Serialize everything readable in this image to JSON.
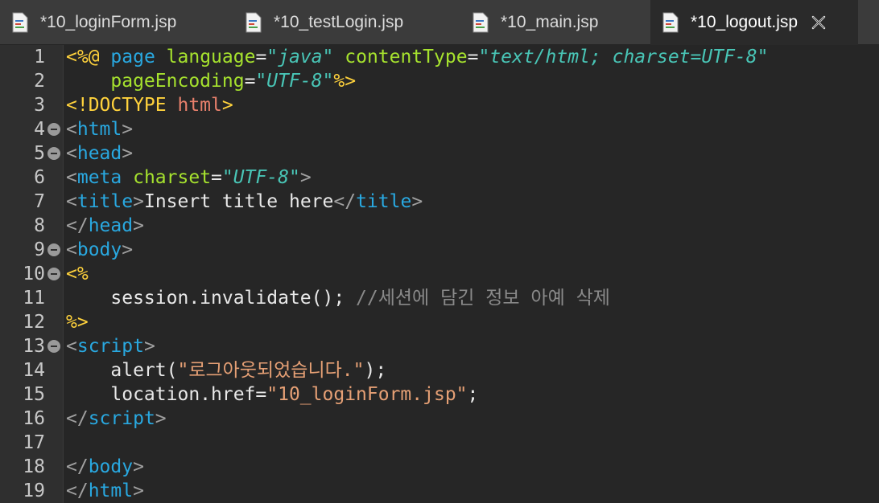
{
  "tabs": [
    {
      "label": "*10_loginForm.jsp",
      "active": false
    },
    {
      "label": "*10_testLogin.jsp",
      "active": false
    },
    {
      "label": "*10_main.jsp",
      "active": false
    },
    {
      "label": "*10_logout.jsp",
      "active": true
    }
  ],
  "line_numbers": [
    "1",
    "2",
    "3",
    "4",
    "5",
    "6",
    "7",
    "8",
    "9",
    "10",
    "11",
    "12",
    "13",
    "14",
    "15",
    "16",
    "17",
    "18",
    "19"
  ],
  "code": {
    "l1": {
      "open": "<%@",
      "page": "page",
      "a1": "language",
      "eq1": "=",
      "v1": "\"java\"",
      "a2": "contentType",
      "eq2": "=",
      "v2": "\"text/html; charset=UTF-8\""
    },
    "l2": {
      "a1": "pageEncoding",
      "eq1": "=",
      "v1": "\"UTF-8\"",
      "close": "%>"
    },
    "l3": {
      "text": "<!DOCTYPE",
      "name": "html",
      "close": ">"
    },
    "l4": {
      "tag": "html"
    },
    "l5": {
      "tag": "head"
    },
    "l6": {
      "tag": "meta",
      "attr": "charset",
      "eq": "=",
      "val": "\"UTF-8\""
    },
    "l7": {
      "tag": "title",
      "text": "Insert title here"
    },
    "l8": {
      "tag": "head"
    },
    "l9": {
      "tag": "body"
    },
    "l10": {
      "text": "<%"
    },
    "l11": {
      "code": "session.invalidate();",
      "comment": "//세션에 담긴 정보 아예 삭제"
    },
    "l12": {
      "text": "%>"
    },
    "l13": {
      "tag": "script"
    },
    "l14": {
      "fn": "alert(",
      "str": "\"로그아웃되었습니다.\"",
      "end": ");"
    },
    "l15": {
      "code": "location.href=",
      "str": "\"10_loginForm.jsp\"",
      "end": ";"
    },
    "l16": {
      "tag": "script"
    },
    "l18": {
      "tag": "body"
    },
    "l19": {
      "tag": "html"
    }
  },
  "colors": {
    "accent_tag": "#29a8e0",
    "attr": "#a6e22e",
    "string": "#e6a075",
    "delimiter": "#ffd23c"
  }
}
